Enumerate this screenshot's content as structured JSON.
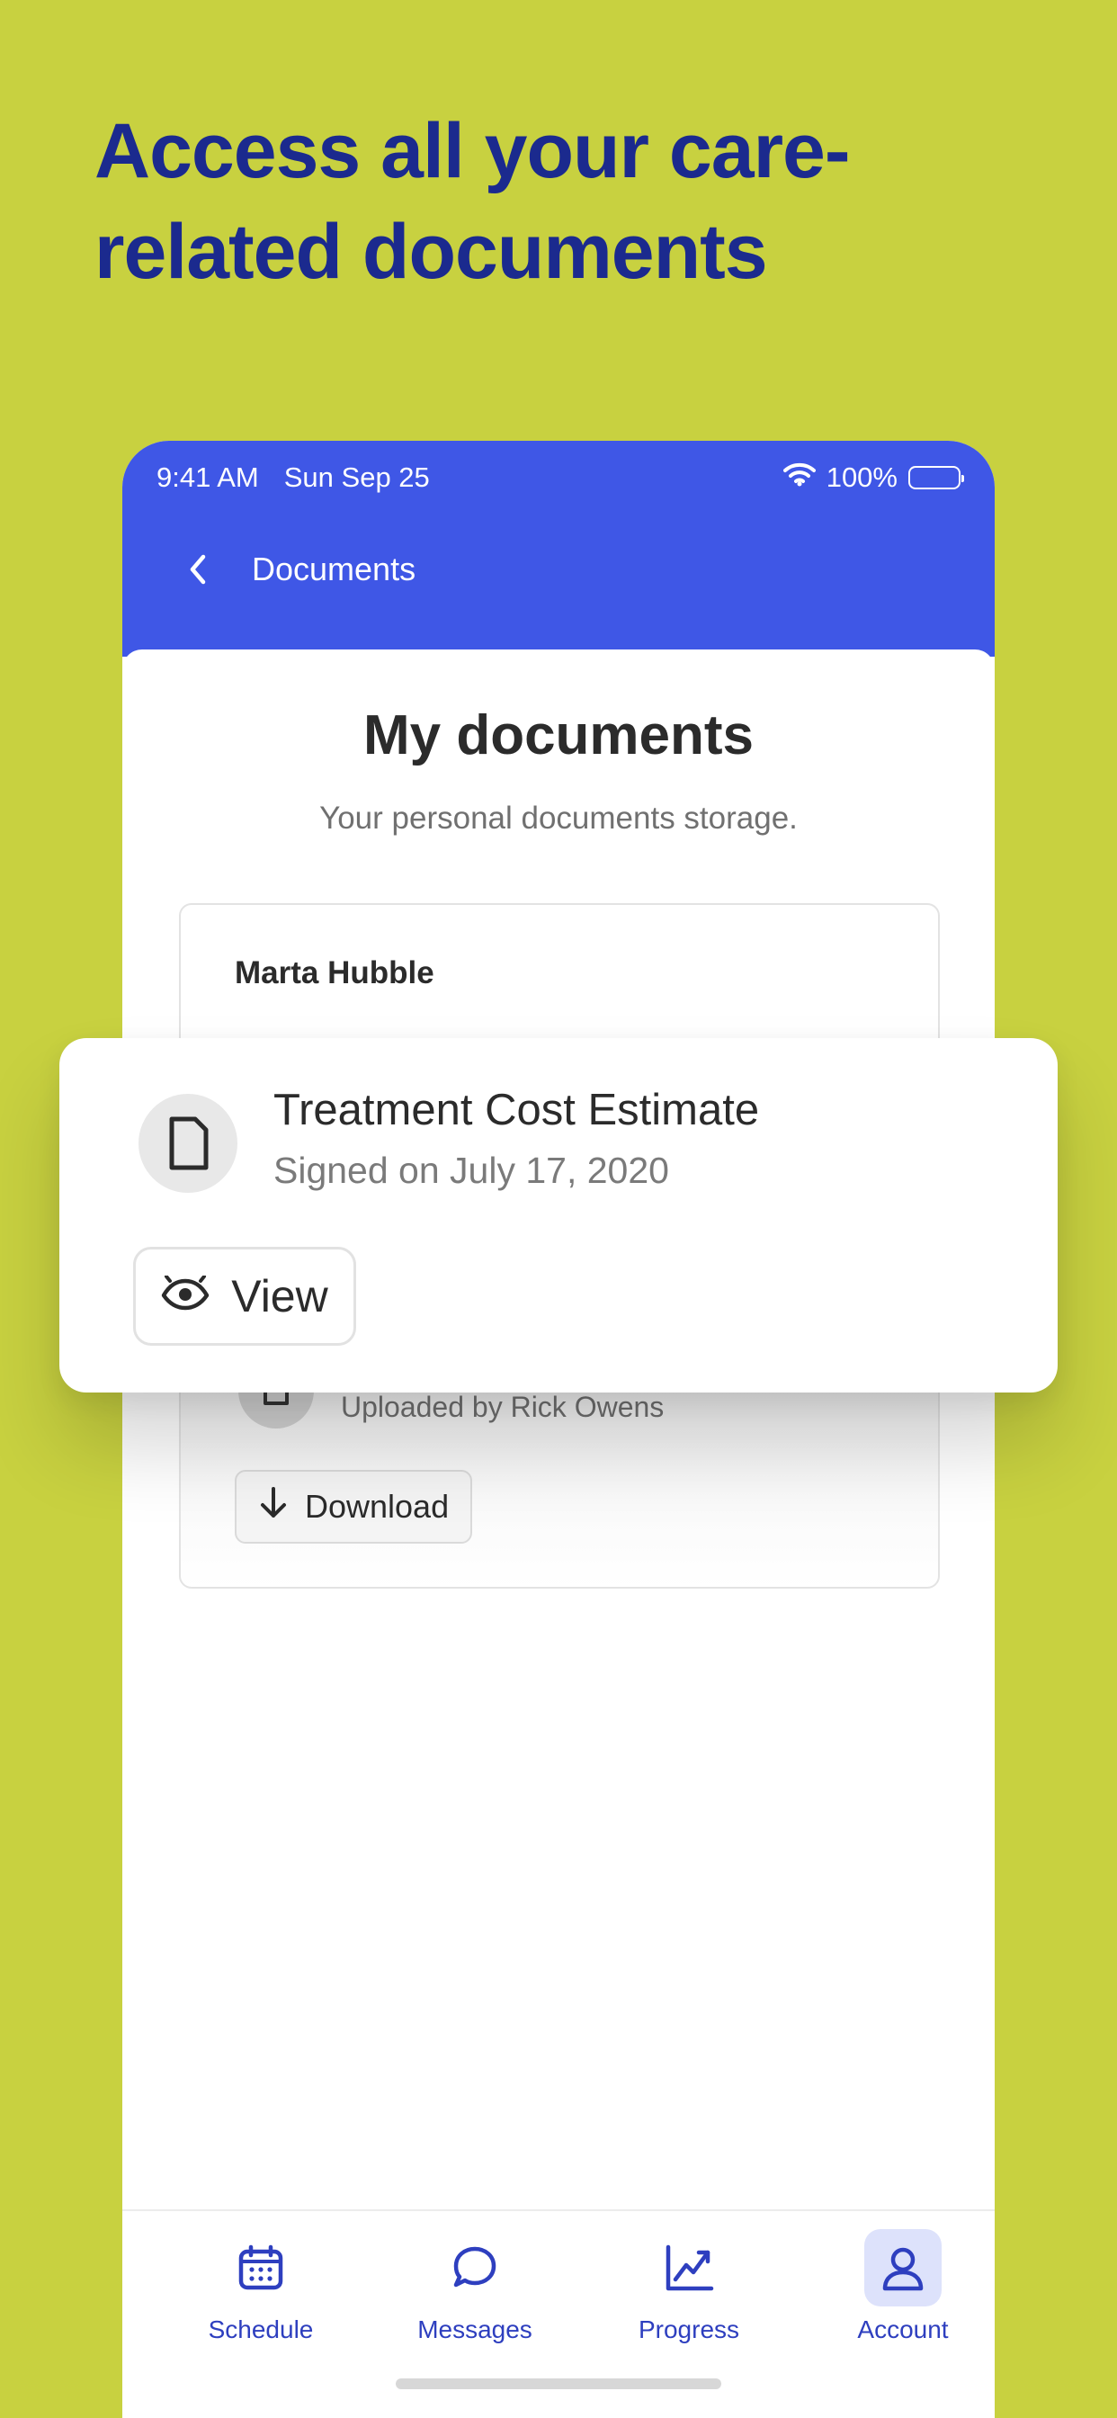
{
  "headline": {
    "line1": "Access all your care-",
    "line2": "related documents"
  },
  "status_bar": {
    "time": "9:41 AM",
    "date": "Sun Sep 25",
    "battery": "100%"
  },
  "nav": {
    "title": "Documents"
  },
  "page": {
    "title": "My documents",
    "subtitle": "Your personal documents storage."
  },
  "document_group": {
    "owner": "Marta Hubble",
    "uploaded_by": "Uploaded by Rick Owens",
    "download_label": "Download"
  },
  "featured_document": {
    "title": "Treatment Cost Estimate",
    "signed": "Signed on July 17, 2020",
    "view_label": "View"
  },
  "tabs": [
    {
      "label": "Schedule",
      "icon": "calendar-icon"
    },
    {
      "label": "Messages",
      "icon": "chat-bubble-icon"
    },
    {
      "label": "Progress",
      "icon": "trend-chart-icon"
    },
    {
      "label": "Account",
      "icon": "user-icon",
      "active": true
    }
  ],
  "colors": {
    "background": "#c8d140",
    "headline": "#1b2a8e",
    "primary": "#3f57e6",
    "tab_accent": "#2e3fbf",
    "tab_active_bg": "#dde2fb"
  }
}
